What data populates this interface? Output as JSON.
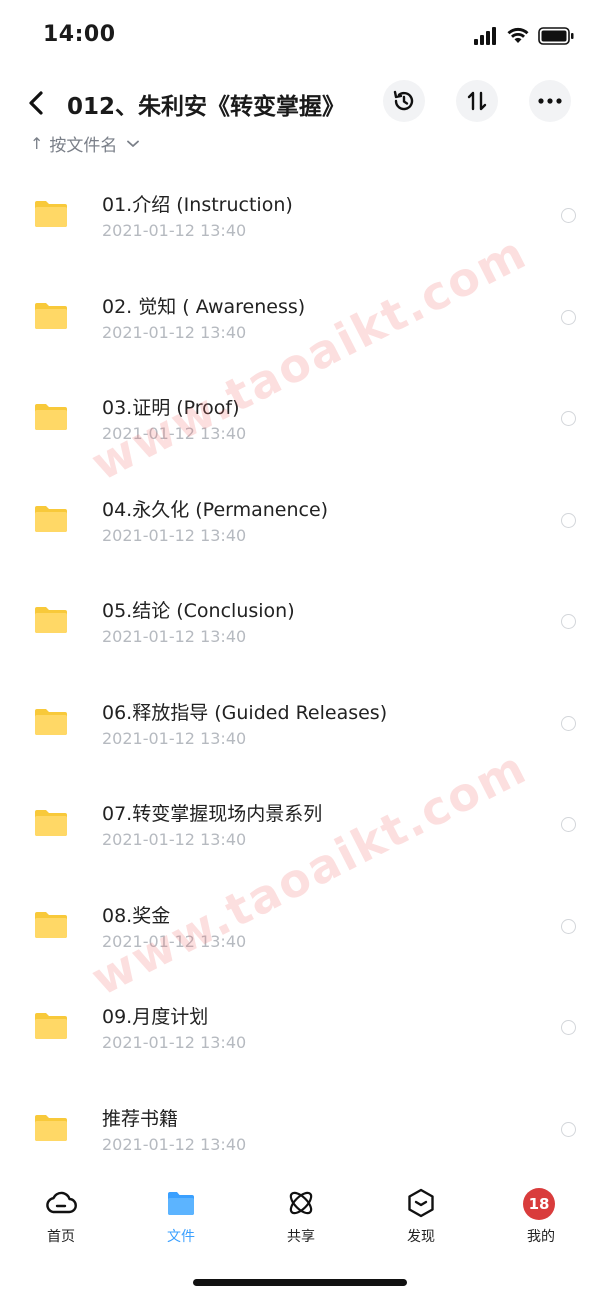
{
  "status_bar": {
    "time": "14:00"
  },
  "header": {
    "title": "012、朱利安《转变掌握》"
  },
  "sort": {
    "label": "按文件名",
    "arrow": "↑"
  },
  "files": [
    {
      "name": "01.介绍 (Instruction)",
      "date": "2021-01-12 13:40"
    },
    {
      "name": "02. 觉知 ( Awareness)",
      "date": "2021-01-12 13:40"
    },
    {
      "name": "03.证明 (Proof)",
      "date": "2021-01-12 13:40"
    },
    {
      "name": "04.永久化 (Permanence)",
      "date": "2021-01-12 13:40"
    },
    {
      "name": "05.结论 (Conclusion)",
      "date": "2021-01-12 13:40"
    },
    {
      "name": "06.释放指导 (Guided Releases)",
      "date": "2021-01-12 13:40"
    },
    {
      "name": "07.转变掌握现场内景系列",
      "date": "2021-01-12 13:40"
    },
    {
      "name": "08.奖金",
      "date": "2021-01-12 13:40"
    },
    {
      "name": "09.月度计划",
      "date": "2021-01-12 13:40"
    },
    {
      "name": "推荐书籍",
      "date": "2021-01-12 13:40"
    }
  ],
  "watermark": "www.taoaikt.com",
  "tabs": [
    {
      "label": "首页",
      "icon": "cloud-icon"
    },
    {
      "label": "文件",
      "icon": "folder-icon",
      "active": true
    },
    {
      "label": "共享",
      "icon": "atom-icon"
    },
    {
      "label": "发现",
      "icon": "discover-icon"
    },
    {
      "label": "我的",
      "icon": "avatar",
      "avatar_text": "18"
    }
  ],
  "colors": {
    "accent": "#3aa0ff",
    "folder": "#ffd866",
    "avatar_bg": "#d93c3c"
  }
}
